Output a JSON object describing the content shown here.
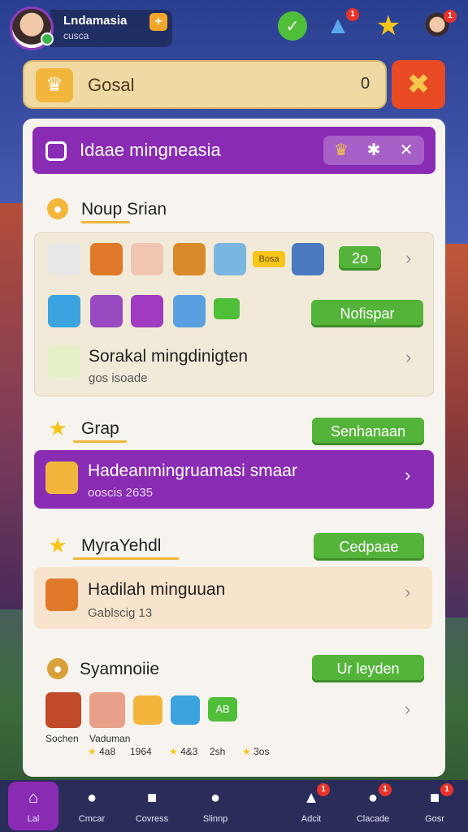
{
  "header": {
    "username": "Lndamasia",
    "user_sub": "cusca",
    "plus_label": "+",
    "notif_badge": "1",
    "char_badge": "1"
  },
  "search": {
    "query": "Gosal",
    "clear_label": "0"
  },
  "panel": {
    "title": "Idaae mingneasia",
    "sections": {
      "first": {
        "title": "Noup Srian",
        "tile_row1_badge": "Bosa",
        "count_button": "2o",
        "action_button": "Nofispar",
        "row_title": "Sorakal mingdinigten",
        "row_sub": "gos isoade"
      },
      "grap": {
        "title": "Grap",
        "button": "Senhanaan",
        "row_title": "Hadeanmingruamasi smaar",
        "row_sub": "ooscis 2635"
      },
      "myra": {
        "title": "MyraYehdl",
        "button": "Cedpaae",
        "row_title": "Hadilah minguuan",
        "row_sub": "Gablscig 13"
      },
      "syam": {
        "title": "Syamnoiie",
        "button": "Ur leyden",
        "apps": [
          {
            "label": "Sochen",
            "rating": ""
          },
          {
            "label": "Vaduman",
            "rating": "4a8"
          },
          {
            "label": "",
            "rating": "1964"
          },
          {
            "label": "",
            "rating": "4&3"
          },
          {
            "label": "",
            "rating": "2sh"
          },
          {
            "label": "",
            "rating": "3os"
          }
        ],
        "tile_label_1": "AB"
      }
    }
  },
  "nav": [
    {
      "label": "Lal"
    },
    {
      "label": "Cmcar"
    },
    {
      "label": "Covress"
    },
    {
      "label": "Slinnp"
    },
    {
      "label": "Adcit"
    },
    {
      "label": "Clacade"
    },
    {
      "label": "Gosr"
    }
  ],
  "colors": {
    "purple": "#8a2bb4",
    "green": "#54b43a",
    "orange_red": "#e84a23",
    "gold": "#f3b63c"
  }
}
